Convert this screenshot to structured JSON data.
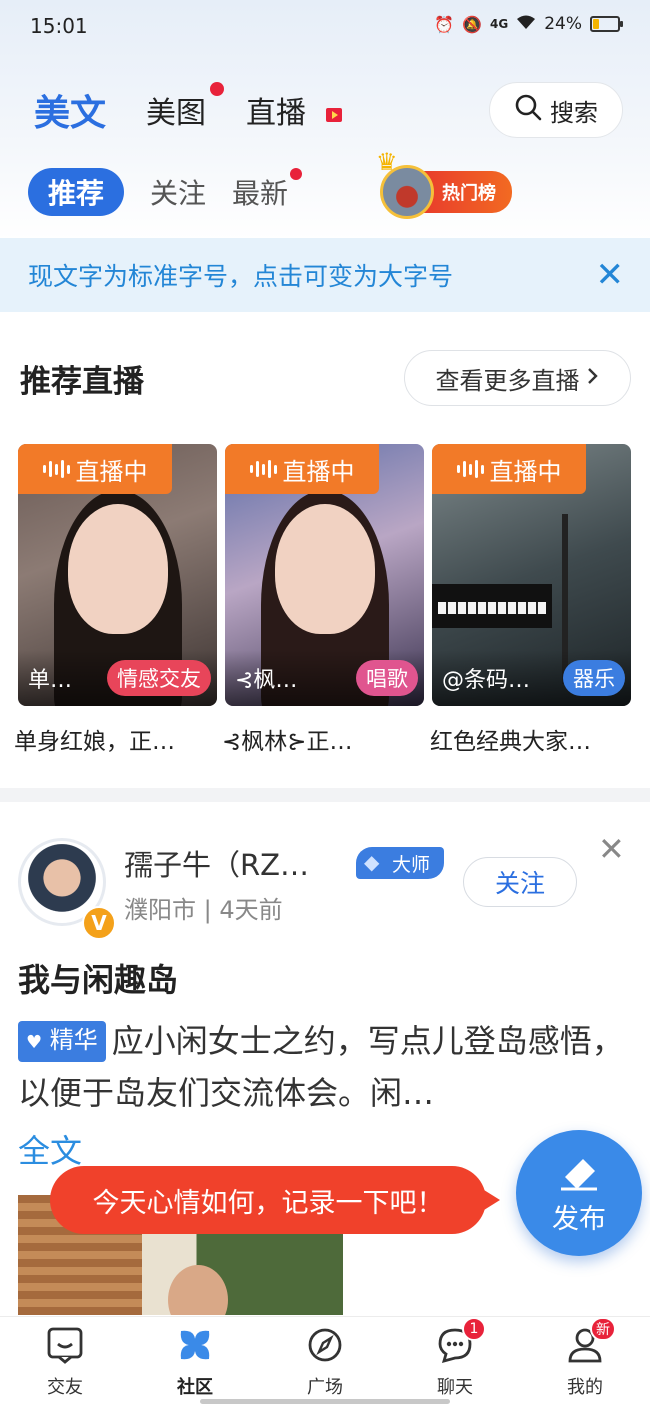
{
  "status_bar": {
    "time": "15:01",
    "battery": "24%",
    "battery_level": 0.24,
    "network": "4G"
  },
  "main_tabs": [
    {
      "label": "美文",
      "active": true,
      "dot": false,
      "live": false
    },
    {
      "label": "美图",
      "active": false,
      "dot": true,
      "live": false
    },
    {
      "label": "直播",
      "active": false,
      "dot": false,
      "live": true
    }
  ],
  "search": {
    "label": "搜索"
  },
  "sub_tabs": [
    {
      "label": "推荐",
      "active": true,
      "dot": false
    },
    {
      "label": "关注",
      "active": false,
      "dot": false
    },
    {
      "label": "最新",
      "active": false,
      "dot": true
    }
  ],
  "hot_rank": {
    "label": "热门榜"
  },
  "notice": {
    "text": "现文字为标准字号，点击可变为大字号",
    "close_icon": "close-icon"
  },
  "live_section": {
    "title": "推荐直播",
    "more_label": "查看更多直播",
    "badge_label": "直播中",
    "cards": [
      {
        "name": "单…",
        "tag": "情感交友",
        "tag_color": "#e8455a",
        "caption": "单身红娘，正…"
      },
      {
        "name": "⊰枫…",
        "tag": "唱歌",
        "tag_color": "#e0558f",
        "caption": "⊰枫林⊱正…"
      },
      {
        "name": "@条码…",
        "tag": "器乐",
        "tag_color": "#3b7de0",
        "caption": "红色经典大家…"
      }
    ]
  },
  "post": {
    "username": "孺子牛（RZ…",
    "master_badge": "大师",
    "location_time": "濮阳市 | 4天前",
    "follow_label": "关注",
    "verified": "V",
    "title": "我与闲趣岛",
    "essence_badge": "精华",
    "excerpt": "应小闲女士之约，写点儿登岛感悟，以便于岛友们交流体会。闲…",
    "full_text_label": "全文"
  },
  "tooltip": {
    "text": "今天心情如何，记录一下吧！"
  },
  "fab": {
    "label": "发布"
  },
  "bottom_nav": [
    {
      "label": "交友",
      "icon": "chat-face-icon",
      "active": false,
      "badge": ""
    },
    {
      "label": "社区",
      "icon": "community-icon",
      "active": true,
      "badge": ""
    },
    {
      "label": "广场",
      "icon": "compass-icon",
      "active": false,
      "badge": ""
    },
    {
      "label": "聊天",
      "icon": "chat-bubble-icon",
      "active": false,
      "badge": "1"
    },
    {
      "label": "我的",
      "icon": "person-icon",
      "active": false,
      "badge": "新"
    }
  ],
  "colors": {
    "accent": "#2b6fe0",
    "live_orange": "#f27a28",
    "alert_red": "#f0412b",
    "notice_blue": "#2386d6"
  }
}
